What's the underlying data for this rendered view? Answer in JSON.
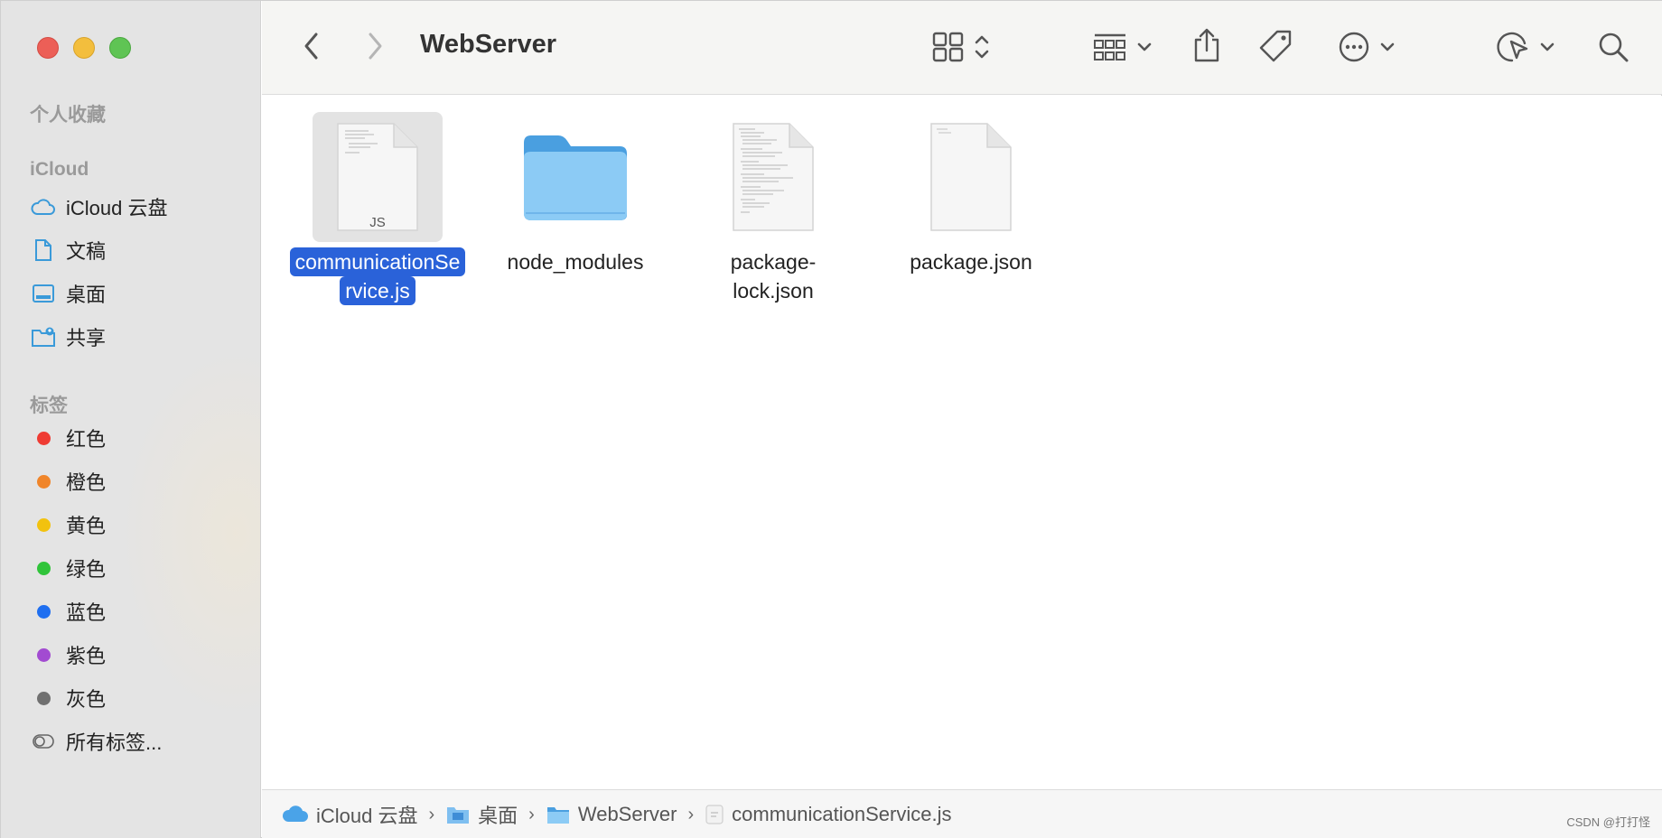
{
  "window": {
    "title": "WebServer"
  },
  "sidebar": {
    "favorites_heading": "个人收藏",
    "icloud_heading": "iCloud",
    "icloud_items": [
      {
        "label": "iCloud 云盘",
        "icon": "cloud-icon"
      },
      {
        "label": "文稿",
        "icon": "document-icon"
      },
      {
        "label": "桌面",
        "icon": "desktop-icon"
      },
      {
        "label": "共享",
        "icon": "shared-folder-icon"
      }
    ],
    "tags_heading": "标签",
    "tags": [
      {
        "label": "红色",
        "color": "#ef3b33"
      },
      {
        "label": "橙色",
        "color": "#f0852a"
      },
      {
        "label": "黄色",
        "color": "#f2c20f"
      },
      {
        "label": "绿色",
        "color": "#30c43a"
      },
      {
        "label": "蓝色",
        "color": "#1f6ff0"
      },
      {
        "label": "紫色",
        "color": "#a24bd1"
      },
      {
        "label": "灰色",
        "color": "#707070"
      }
    ],
    "all_tags_label": "所有标签..."
  },
  "toolbar": {
    "icons": [
      "back-icon",
      "forward-icon",
      "grid-view-icon",
      "group-icon",
      "share-icon",
      "tag-icon",
      "more-icon",
      "markup-icon",
      "search-icon"
    ]
  },
  "files": [
    {
      "name_line1": "communicationSe",
      "name_line2": "rvice.js",
      "type": "js",
      "badge": "JS",
      "selected": true
    },
    {
      "name_line1": "node_modules",
      "name_line2": "",
      "type": "folder",
      "selected": false
    },
    {
      "name_line1": "package-",
      "name_line2": "lock.json",
      "type": "text",
      "selected": false
    },
    {
      "name_line1": "package.json",
      "name_line2": "",
      "type": "blank",
      "selected": false
    }
  ],
  "pathbar": {
    "crumbs": [
      "iCloud 云盘",
      "桌面",
      "WebServer",
      "communicationService.js"
    ]
  },
  "watermark": "CSDN @打打怪"
}
